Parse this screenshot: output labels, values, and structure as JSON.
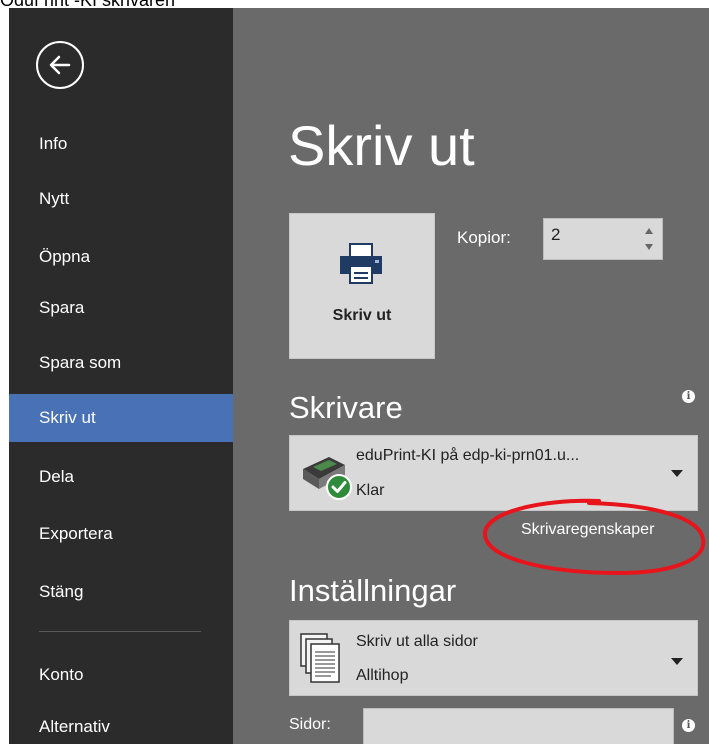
{
  "cutoff_text": "Oduf rint -KI skrivaren",
  "sidebar": {
    "items": [
      {
        "label": "Info"
      },
      {
        "label": "Nytt"
      },
      {
        "label": "Öppna"
      },
      {
        "label": "Spara"
      },
      {
        "label": "Spara som"
      },
      {
        "label": "Skriv ut",
        "active": true
      },
      {
        "label": "Dela"
      },
      {
        "label": "Exportera"
      },
      {
        "label": "Stäng"
      },
      {
        "label": "Konto"
      },
      {
        "label": "Alternativ"
      }
    ]
  },
  "main": {
    "title": "Skriv ut",
    "print_button_label": "Skriv ut",
    "copies_label": "Kopior:",
    "copies_value": "2",
    "printer_heading": "Skrivare",
    "printer_name": "eduPrint-KI på edp-ki-prn01.u...",
    "printer_status": "Klar",
    "printer_properties_link": "Skrivaregenskaper",
    "settings_heading": "Inställningar",
    "pages_option_main": "Skriv ut alla sidor",
    "pages_option_sub": "Alltihop",
    "pages_label": "Sidor:",
    "pages_value": ""
  },
  "icons": {
    "back": "back-arrow-icon",
    "printer": "printer-icon",
    "network_printer": "network-printer-icon",
    "ready_check": "check-icon",
    "document_pages": "document-pages-icon",
    "info": "info-icon"
  },
  "colors": {
    "sidebar_bg": "#2b2b2b",
    "sidebar_active": "#4872b5",
    "main_bg": "#6a6a6a",
    "control_bg": "#d9d9d9",
    "annotation_red": "#e8141b"
  }
}
